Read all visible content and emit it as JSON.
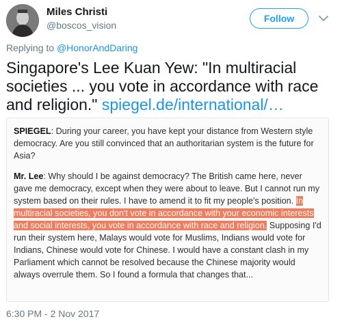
{
  "author": {
    "name": "Miles Christi",
    "handle": "@boscos_vision"
  },
  "follow_label": "Follow",
  "reply": {
    "prefix": "Replying to ",
    "mention": "@HonorAndDaring"
  },
  "tweet": {
    "text": "Singapore's Lee Kuan Yew: \"In multiracial societies ... you vote in accordance with race and religion.\" ",
    "link": "spiegel.de/international/…"
  },
  "quote": {
    "q_speaker": "SPIEGEL",
    "q_text": ": During your career, you have kept your distance from Western style democracy. Are you still convinced that an authoritarian system is the future for Asia?",
    "a_speaker": "Mr. Lee",
    "a_text_1": ": Why should I be against democracy? The British came here, never gave me democracy, except when they were about to leave. But I cannot run my system based on their rules. I have to amend it to fit my people's position. ",
    "a_highlight": "In multiracial societies, you don't vote in accordance with your economic interests and social interests, you vote in accordance with race and religion.",
    "a_text_2": " Supposing I'd run their system here, Malays would vote for Muslims, Indians would vote for Indians, Chinese would vote for Chinese. I would have a constant clash in my Parliament which cannot be resolved because the Chinese majority would always overrule them. So I found a formula that changes that..."
  },
  "timestamp": "6:30 PM - 2 Nov 2017",
  "colors": {
    "accent": "#1da1f2",
    "highlight": "#ef7d5e",
    "muted": "#657786"
  },
  "icons": {
    "avatar": "profile-photo",
    "menu": "chevron-down-icon"
  }
}
